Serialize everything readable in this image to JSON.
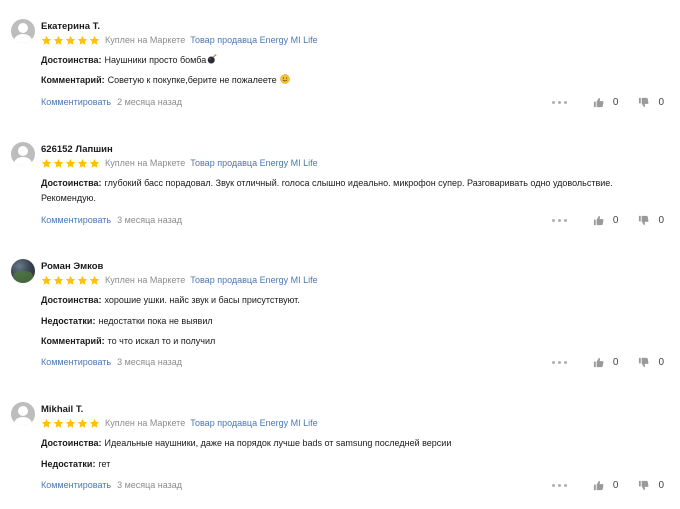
{
  "labels": {
    "bought": "Куплен на Маркете",
    "seller": "Товар продавца Energy MI Life",
    "comment_link": "Комментировать",
    "pros": "Достоинства:",
    "cons": "Недостатки:",
    "comment": "Комментарий:"
  },
  "colors": {
    "star": "#ffc107",
    "link": "#4a78b5",
    "muted": "#8c8c8c"
  },
  "reviews": [
    {
      "author": "Екатерина Т.",
      "rating": 5,
      "pros": "Наушники просто бомба",
      "comment": "Советую к покупке,берите не пожалеете",
      "date": "2 месяца назад",
      "likes": "0",
      "dislikes": "0"
    },
    {
      "author": "626152 Лапшин",
      "rating": 5,
      "pros": "глубокий басс порадовал. Звук отличный. голоса слышно идеально. микрофон супер. Разговаривать одно удовольствие. Рекомендую.",
      "date": "3 месяца назад",
      "likes": "0",
      "dislikes": "0"
    },
    {
      "author": "Роман Эмков",
      "rating": 5,
      "pros": "хорошие ушки. найс звук и басы присутствуют.",
      "cons": "недостатки пока не выявил",
      "comment": "то что искал то и получил",
      "date": "3 месяца назад",
      "likes": "0",
      "dislikes": "0"
    },
    {
      "author": "Mikhail T.",
      "rating": 5,
      "pros": "Идеальные наушники, даже на порядок лучше bads от samsung последней версии",
      "cons": "гет",
      "date": "3 месяца назад",
      "likes": "0",
      "dislikes": "0"
    }
  ]
}
